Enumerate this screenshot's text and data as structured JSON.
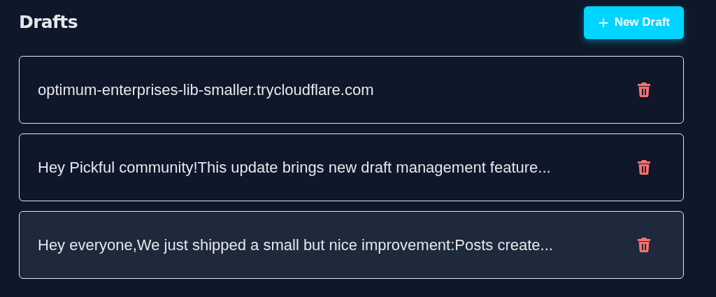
{
  "header": {
    "title": "Drafts",
    "new_button": {
      "icon": "+",
      "label": "New Draft"
    }
  },
  "drafts": [
    {
      "text": "optimum-enterprises-lib-smaller.trycloudflare.com",
      "selected": false
    },
    {
      "text": "Hey Pickful community!This update brings new draft management feature...",
      "selected": false
    },
    {
      "text": "Hey everyone,We just shipped a small but nice improvement:Posts create...",
      "selected": true
    }
  ]
}
